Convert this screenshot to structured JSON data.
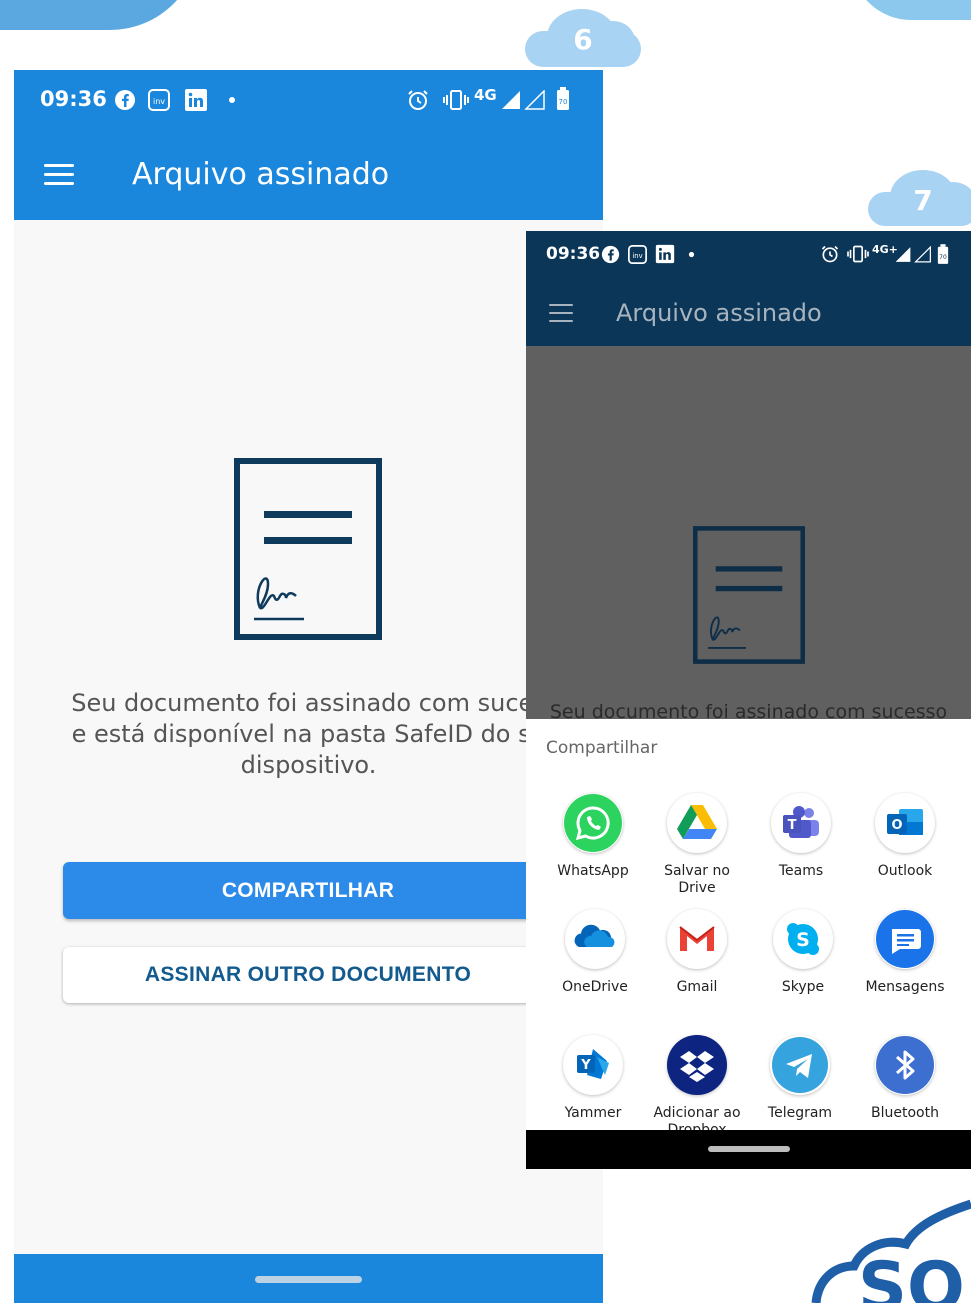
{
  "steps": {
    "first": "6",
    "second": "7"
  },
  "colors": {
    "app_bar_blue": "#1a87dc",
    "dark_app_bar": "#0b3657",
    "share_button": "#2c8ae8",
    "doc_stroke": "#0e3b5c"
  },
  "screen_one": {
    "status": {
      "time": "09:36",
      "network": "4G",
      "battery": "70"
    },
    "title": "Arquivo assinado",
    "message_lines": [
      "Seu documento foi assinado com suces",
      "e está disponível na pasta SafeID do se",
      "dispositivo."
    ],
    "share_button": "COMPARTILHAR",
    "sign_other_button": "ASSINAR OUTRO DOCUMENTO"
  },
  "screen_two": {
    "status": {
      "time": "09:36",
      "network": "4G+",
      "battery": "70"
    },
    "title": "Arquivo assinado",
    "message": "Seu documento foi assinado com sucesso",
    "sheet_title": "Compartilhar",
    "apps": [
      {
        "line1": "WhatsApp",
        "line2": "",
        "icon": "whatsapp-icon"
      },
      {
        "line1": "Salvar no",
        "line2": "Drive",
        "icon": "google-drive-icon"
      },
      {
        "line1": "Teams",
        "line2": "",
        "icon": "teams-icon"
      },
      {
        "line1": "Outlook",
        "line2": "",
        "icon": "outlook-icon"
      },
      {
        "line1": "OneDrive",
        "line2": "",
        "icon": "onedrive-icon"
      },
      {
        "line1": "Gmail",
        "line2": "",
        "icon": "gmail-icon"
      },
      {
        "line1": "Skype",
        "line2": "",
        "icon": "skype-icon"
      },
      {
        "line1": "Mensagens",
        "line2": "",
        "icon": "messages-icon"
      },
      {
        "line1": "Yammer",
        "line2": "",
        "icon": "yammer-icon"
      },
      {
        "line1": "Adicionar ao",
        "line2": "Dropbox",
        "icon": "dropbox-icon"
      },
      {
        "line1": "Telegram",
        "line2": "",
        "icon": "telegram-icon"
      },
      {
        "line1": "Bluetooth",
        "line2": "",
        "icon": "bluetooth-icon"
      }
    ]
  },
  "logo": {
    "text": "SO"
  }
}
